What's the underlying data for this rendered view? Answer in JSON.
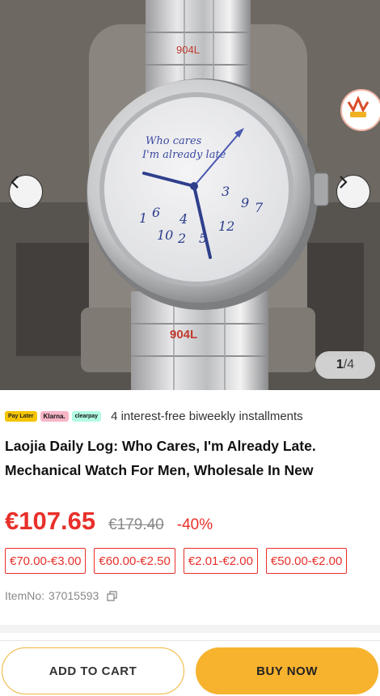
{
  "gallery": {
    "counter_current": "1",
    "counter_total": "/4",
    "watch_dial_text_1": "Who cares",
    "watch_dial_text_2": "I'm already late",
    "bracelet_stamp": "904L",
    "badge_text": "Vogioo"
  },
  "product": {
    "installments_text": "4 interest-free biweekly installments",
    "pay_later_label": "Pay Later",
    "klarna_label": "Klarna.",
    "clearpay_label": "clearpay",
    "title": "Laojia Daily Log: Who Cares, I'm Already Late. Mechanical Watch For Men, Wholesale In New",
    "price": "€107.65",
    "old_price": "€179.40",
    "discount": "-40%",
    "price_tiers": [
      "€70.00-€3.00",
      "€60.00-€2.50",
      "€2.01-€2.00",
      "€50.00-€2.00"
    ],
    "item_no_label": "ItemNo:",
    "item_no": "37015593"
  },
  "actions": {
    "add_to_cart": "ADD TO CART",
    "buy_now": "BUY NOW"
  },
  "colors": {
    "accent_red": "#e8302a",
    "buy_yellow": "#f7b22e"
  }
}
